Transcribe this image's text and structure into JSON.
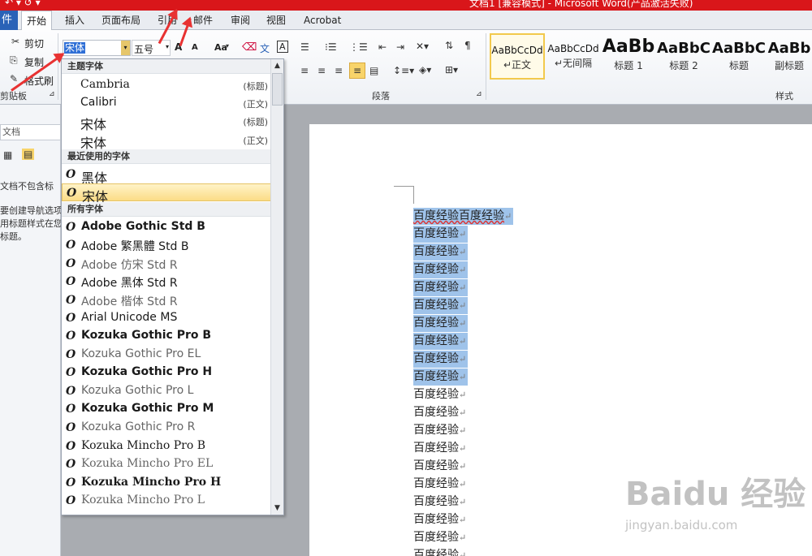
{
  "titlebar": {
    "quick_access": "↶ ▾ ↺ ▾",
    "title": "文档1 [兼容模式] - Microsoft Word(产品激活失败)",
    "color": "#d9161a"
  },
  "tabs": {
    "file": "件",
    "items": [
      "开始",
      "插入",
      "页面布局",
      "引用",
      "邮件",
      "审阅",
      "视图",
      "Acrobat"
    ]
  },
  "clipboard": {
    "cut": "剪切",
    "copy": "复制",
    "format_painter": "格式刷",
    "group_label": "剪贴板"
  },
  "font_group": {
    "font_value": "宋体",
    "size_value": "五号",
    "grow": "A",
    "shrink": "A",
    "change_case": "Aa",
    "clear_format": "A",
    "phonetic": "文",
    "border": "A"
  },
  "paragraph": {
    "group_label": "段落"
  },
  "styles": {
    "group_label": "样式",
    "items": [
      {
        "sample": "AaBbCcDd",
        "name": "↵正文"
      },
      {
        "sample": "AaBbCcDd",
        "name": "↵无间隔"
      },
      {
        "sample": "AaBb",
        "name": "标题 1"
      },
      {
        "sample": "AaBbC",
        "name": "标题 2"
      },
      {
        "sample": "AaBbC",
        "name": "标题"
      },
      {
        "sample": "AaBb",
        "name": "副标题"
      }
    ]
  },
  "nav_pane": {
    "search_placeholder": "文档",
    "lines": [
      "文档不包含标",
      "要创建导航选项卡",
      "用标题样式在您的",
      "标题。"
    ]
  },
  "font_dropdown": {
    "theme_header": "主题字体",
    "theme_fonts": [
      {
        "name": "Cambria",
        "tag": "(标题)"
      },
      {
        "name": "Calibri",
        "tag": "(正文)"
      },
      {
        "name": "宋体",
        "tag": "(标题)"
      },
      {
        "name": "宋体",
        "tag": "(正文)"
      }
    ],
    "recent_header": "最近使用的字体",
    "recent_fonts": [
      "黑体",
      "宋体"
    ],
    "all_header": "所有字体",
    "all_fonts": [
      "Adobe Gothic Std B",
      "Adobe 繁黑體 Std B",
      "Adobe 仿宋 Std R",
      "Adobe 黑体 Std R",
      "Adobe 楷体 Std R",
      "Arial Unicode MS",
      "Kozuka Gothic Pro B",
      "Kozuka Gothic Pro EL",
      "Kozuka Gothic Pro H",
      "Kozuka Gothic Pro L",
      "Kozuka Gothic Pro M",
      "Kozuka Gothic Pro R",
      "Kozuka Mincho Pro B",
      "Kozuka Mincho Pro EL",
      "Kozuka Mincho Pro H",
      "Kozuka Mincho Pro L"
    ],
    "truetype_icon": "O"
  },
  "document": {
    "first_line": "百度经验百度经验",
    "line_text": "百度经验",
    "para_mark": "↵",
    "highlight_color": "#9fc3ea"
  },
  "watermark": {
    "big": "Baidu 经验",
    "small": "jingyan.baidu.com"
  }
}
